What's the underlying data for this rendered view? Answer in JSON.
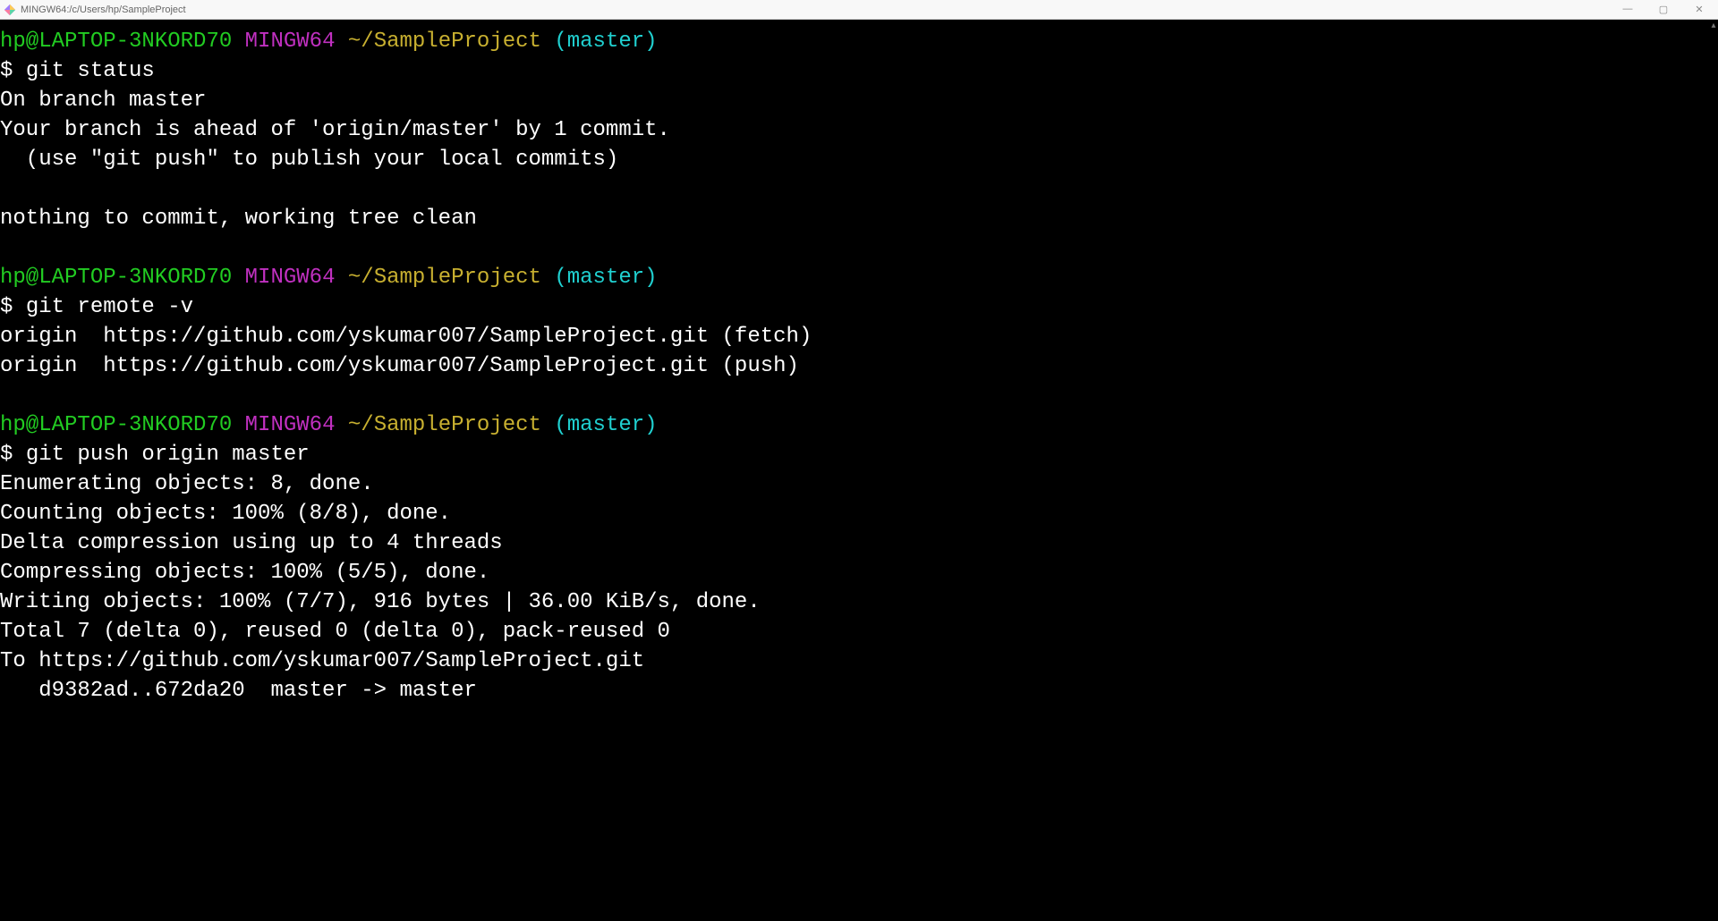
{
  "window": {
    "title": "MINGW64:/c/Users/hp/SampleProject"
  },
  "prompt": {
    "user_host": "hp@LAPTOP-3NKORD70",
    "env": "MINGW64",
    "path": "~/SampleProject",
    "branch": "(master)",
    "sigil": "$"
  },
  "block1": {
    "cmd": "git status",
    "l1": "On branch master",
    "l2": "Your branch is ahead of 'origin/master' by 1 commit.",
    "l3": "  (use \"git push\" to publish your local commits)",
    "l4": "",
    "l5": "nothing to commit, working tree clean"
  },
  "block2": {
    "cmd": "git remote -v",
    "l1": "origin  https://github.com/yskumar007/SampleProject.git (fetch)",
    "l2": "origin  https://github.com/yskumar007/SampleProject.git (push)"
  },
  "block3": {
    "cmd": "git push origin master",
    "l1": "Enumerating objects: 8, done.",
    "l2": "Counting objects: 100% (8/8), done.",
    "l3": "Delta compression using up to 4 threads",
    "l4": "Compressing objects: 100% (5/5), done.",
    "l5": "Writing objects: 100% (7/7), 916 bytes | 36.00 KiB/s, done.",
    "l6": "Total 7 (delta 0), reused 0 (delta 0), pack-reused 0",
    "l7": "To https://github.com/yskumar007/SampleProject.git",
    "l8": "   d9382ad..672da20  master -> master"
  }
}
